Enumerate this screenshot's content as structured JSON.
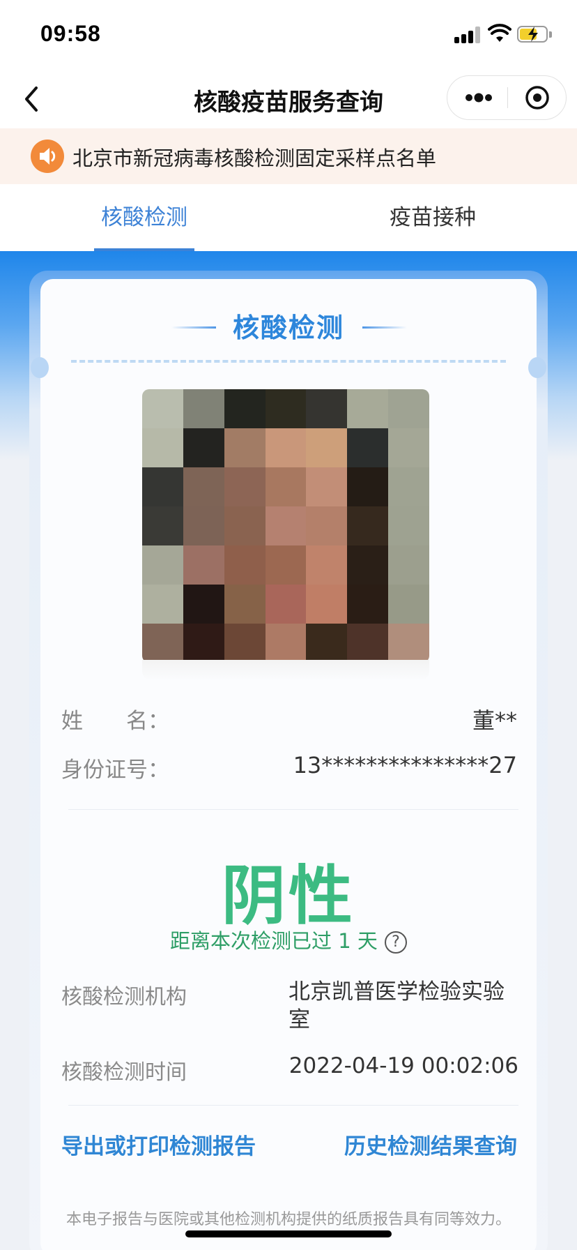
{
  "status_bar": {
    "time": "09:58"
  },
  "nav": {
    "title": "核酸疫苗服务查询"
  },
  "notice": {
    "text": "北京市新冠病毒核酸检测固定采样点名单"
  },
  "tabs": [
    {
      "label": "核酸检测",
      "active": true
    },
    {
      "label": "疫苗接种",
      "active": false
    }
  ],
  "card": {
    "heading": "核酸检测",
    "name_label": "姓　　名：",
    "name_value": "董**",
    "id_label": "身份证号：",
    "id_value": "13***************27",
    "result": "阴性",
    "since_text": "距离本次检测已过 1 天",
    "help_glyph": "?",
    "institution_label": "核酸检测机构",
    "institution_value": "北京凯普医学检验实验室",
    "time_label": "核酸检测时间",
    "time_value": "2022-04-19 00:02:06",
    "export_link": "导出或打印检测报告",
    "history_link": "历史检测结果查询",
    "footnote": "本电子报告与医院或其他检测机构提供的纸质报告具有同等效力。"
  },
  "colors": {
    "accent_blue": "#3d82d6",
    "result_green": "#3cbb82",
    "notice_bg": "#fcf2ec",
    "speaker_orange": "#f28a3a"
  },
  "icons": {
    "back": "chevron-left-icon",
    "more": "more-dots-icon",
    "close": "target-close-icon",
    "speaker": "speaker-icon",
    "help": "question-circle-icon"
  }
}
